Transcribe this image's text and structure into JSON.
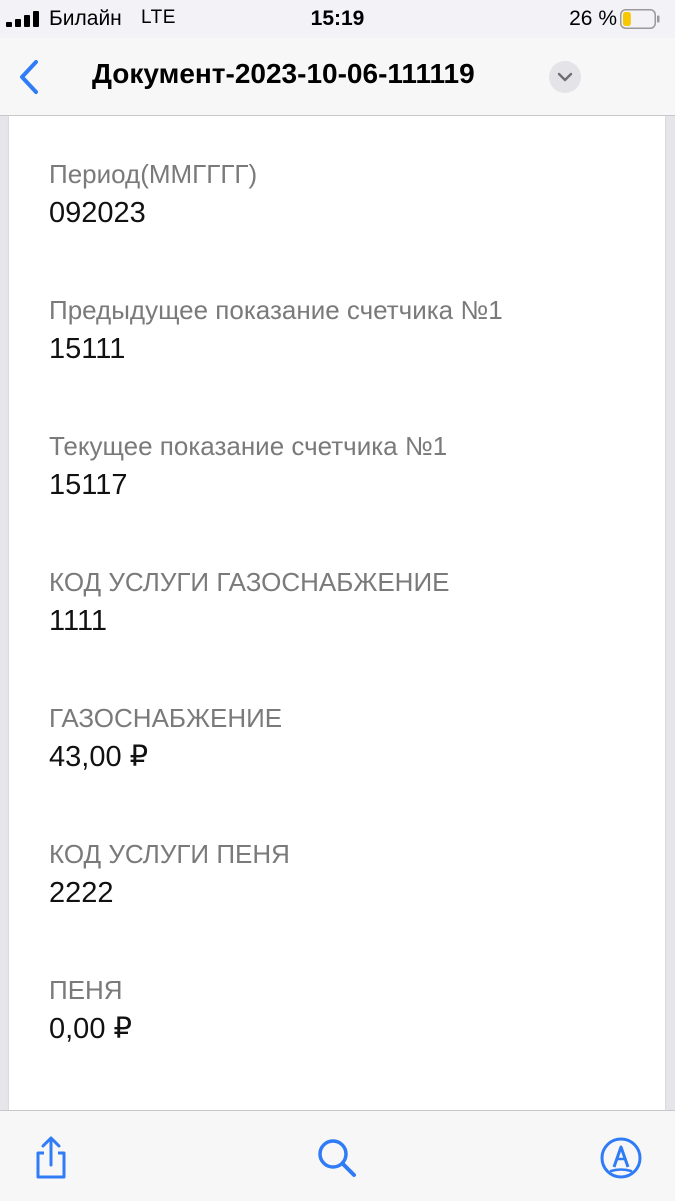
{
  "status_bar": {
    "carrier": "Билайн",
    "network": "LTE",
    "time": "15:19",
    "battery_percent": "26 %",
    "battery_level": 0.26,
    "battery_color": "#f7c700"
  },
  "nav": {
    "title": "Документ-2023-10-06-111119",
    "back_icon": "chevron-left-icon",
    "menu_icon": "chevron-down-icon",
    "accent_color": "#2f7cf6"
  },
  "document": {
    "fields": [
      {
        "label": "Период(ММГГГГ)",
        "value": "092023"
      },
      {
        "label": "Предыдущее показание счетчика №1",
        "value": "15111"
      },
      {
        "label": "Текущее показание счетчика №1",
        "value": "15117"
      },
      {
        "label": "КОД УСЛУГИ ГАЗОСНАБЖЕНИЕ",
        "value": "1111"
      },
      {
        "label": "ГАЗОСНАБЖЕНИЕ",
        "value": "43,00 ₽"
      },
      {
        "label": "КОД УСЛУГИ ПЕНЯ",
        "value": "2222"
      },
      {
        "label": "ПЕНЯ",
        "value": "0,00 ₽"
      }
    ]
  },
  "toolbar": {
    "share_icon": "share-icon",
    "search_icon": "search-icon",
    "markup_icon": "markup-pen-icon"
  }
}
